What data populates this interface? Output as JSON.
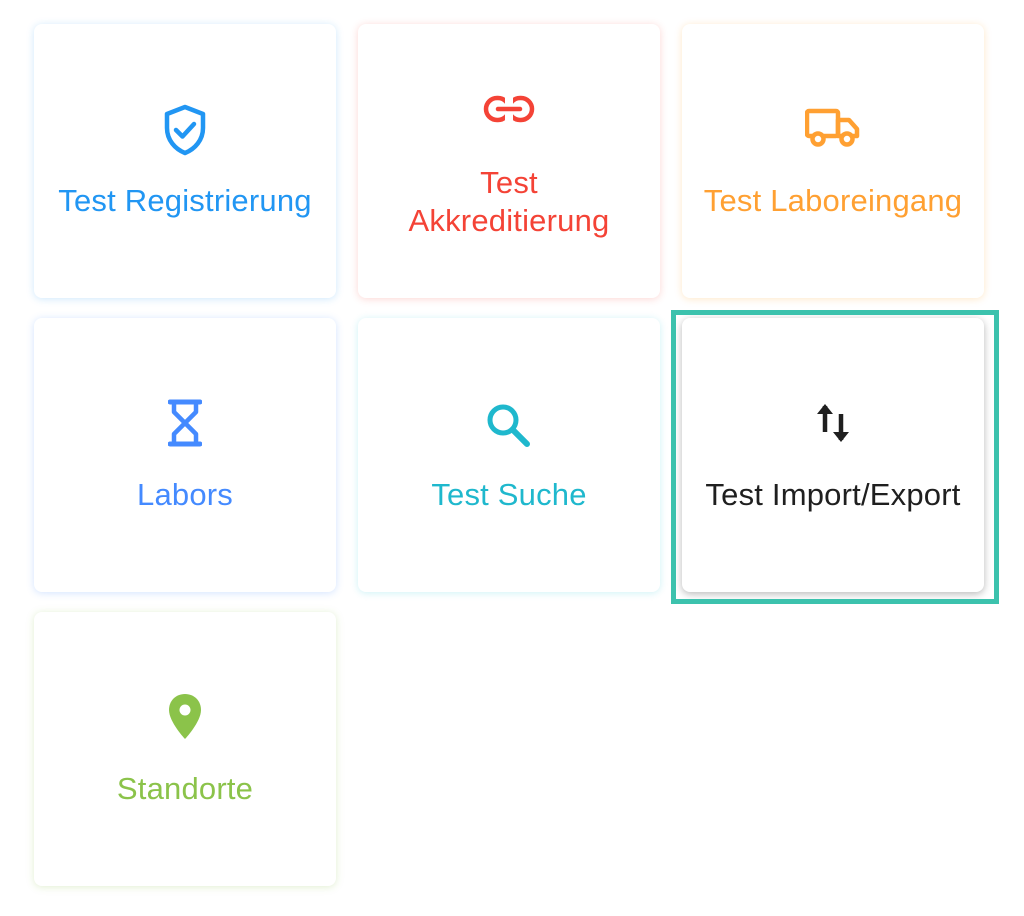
{
  "tiles": [
    {
      "label": "Test Registrierung",
      "icon": "shield-check-icon",
      "color": "#2196f3"
    },
    {
      "label": "Test\nAkkreditierung",
      "icon": "link-icon",
      "color": "#f44336"
    },
    {
      "label": "Test Laboreingang",
      "icon": "truck-icon",
      "color": "#ffa032"
    },
    {
      "label": "Labors",
      "icon": "hourglass-icon",
      "color": "#448aff"
    },
    {
      "label": "Test Suche",
      "icon": "search-icon",
      "color": "#1fb8cd"
    },
    {
      "label": "Test Import/Export",
      "icon": "swap-vertical-icon",
      "color": "#1f1f1f"
    },
    {
      "label": "Standorte",
      "icon": "map-marker-icon",
      "color": "#8bc34a"
    }
  ],
  "highlight_color": "#3cc2ad"
}
